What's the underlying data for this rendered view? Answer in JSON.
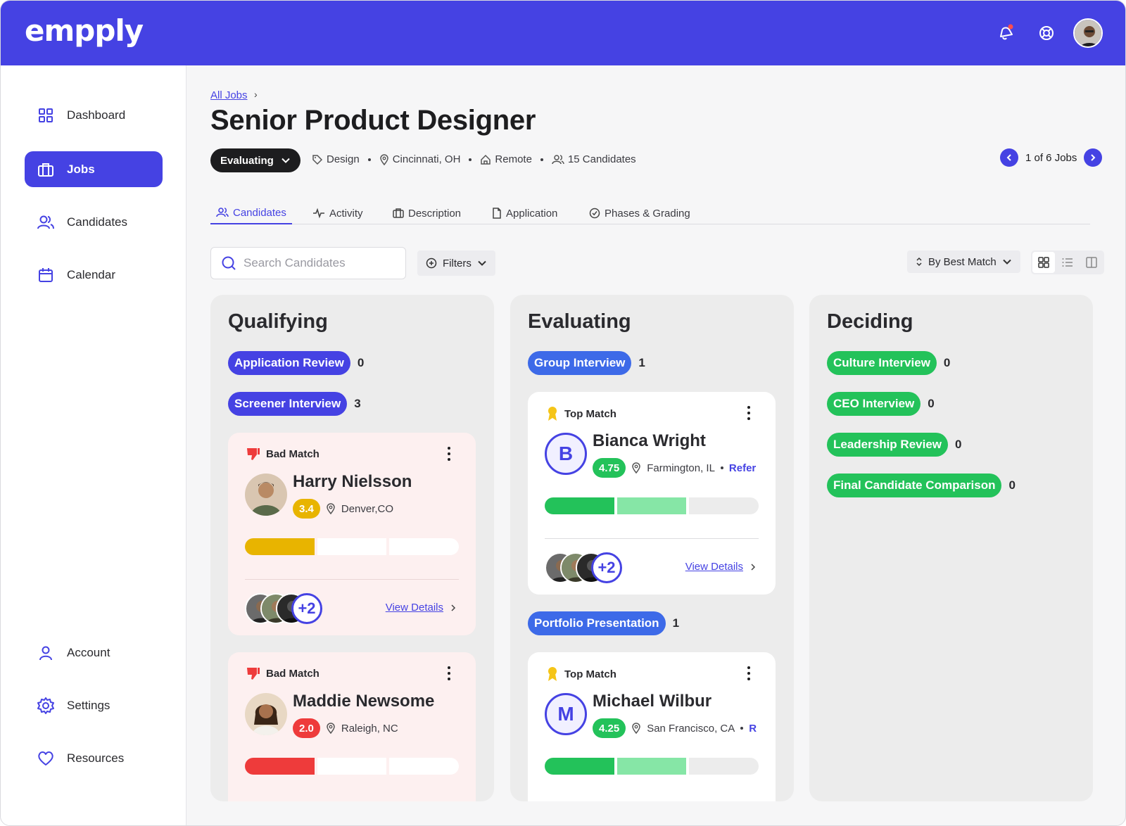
{
  "app": {
    "logo": "empply",
    "accent": "#4542e3"
  },
  "sidebar": {
    "items": [
      {
        "label": "Dashboard",
        "icon": "grid-icon"
      },
      {
        "label": "Jobs",
        "icon": "briefcase-icon",
        "active": true
      },
      {
        "label": "Candidates",
        "icon": "users-icon"
      },
      {
        "label": "Calendar",
        "icon": "calendar-icon"
      },
      {
        "label": "Account",
        "icon": "user-icon"
      },
      {
        "label": "Settings",
        "icon": "gear-icon"
      },
      {
        "label": "Resources",
        "icon": "heart-icon"
      }
    ]
  },
  "header": {
    "breadcrumb": "All Jobs",
    "title": "Senior Product Designer",
    "status": "Evaluating",
    "meta": {
      "department": "Design",
      "location": "Cincinnati, OH",
      "work_type": "Remote",
      "candidates": "15 Candidates"
    },
    "job_pager": "1 of 6 Jobs"
  },
  "tabs": [
    {
      "label": "Candidates",
      "active": true
    },
    {
      "label": "Activity"
    },
    {
      "label": "Description"
    },
    {
      "label": "Application"
    },
    {
      "label": "Phases & Grading"
    }
  ],
  "toolbar": {
    "search_placeholder": "Search Candidates",
    "filters_label": "Filters",
    "sort_label": "By Best Match"
  },
  "columns": {
    "qualifying": {
      "title": "Qualifying",
      "phases": [
        {
          "label": "Application Review",
          "count": "0"
        },
        {
          "label": "Screener Interview",
          "count": "3"
        }
      ],
      "cards": [
        {
          "badge": "Bad Match",
          "name": "Harry Nielsson",
          "score": "3.4",
          "location": "Denver,CO",
          "reviewers_more": "+2",
          "view_details": "View Details",
          "score_color": "#e8b400",
          "fill": 0.33
        },
        {
          "badge": "Bad Match",
          "name": "Maddie Newsome",
          "score": "2.0",
          "location": "Raleigh, NC",
          "score_color": "#ee3b3b",
          "fill": 0.33
        }
      ]
    },
    "evaluating": {
      "title": "Evaluating",
      "phases": [
        {
          "label": "Group Interview",
          "count": "1"
        },
        {
          "label": "Portfolio Presentation",
          "count": "1"
        }
      ],
      "cards": [
        {
          "badge": "Top Match",
          "initial": "B",
          "name": "Bianca Wright",
          "score": "4.75",
          "location": "Farmington, IL",
          "refer": "Refer",
          "reviewers_more": "+2",
          "view_details": "View Details",
          "fill": 0.67
        },
        {
          "badge": "Top Match",
          "initial": "M",
          "name": "Michael Wilbur",
          "score": "4.25",
          "location": "San Francisco, CA",
          "refer": "R",
          "fill": 0.67
        }
      ]
    },
    "deciding": {
      "title": "Deciding",
      "phases": [
        {
          "label": "Culture Interview",
          "count": "0"
        },
        {
          "label": "CEO Interview",
          "count": "0"
        },
        {
          "label": "Leadership Review",
          "count": "0"
        },
        {
          "label": "Final Candidate Comparison",
          "count": "0"
        }
      ]
    }
  }
}
